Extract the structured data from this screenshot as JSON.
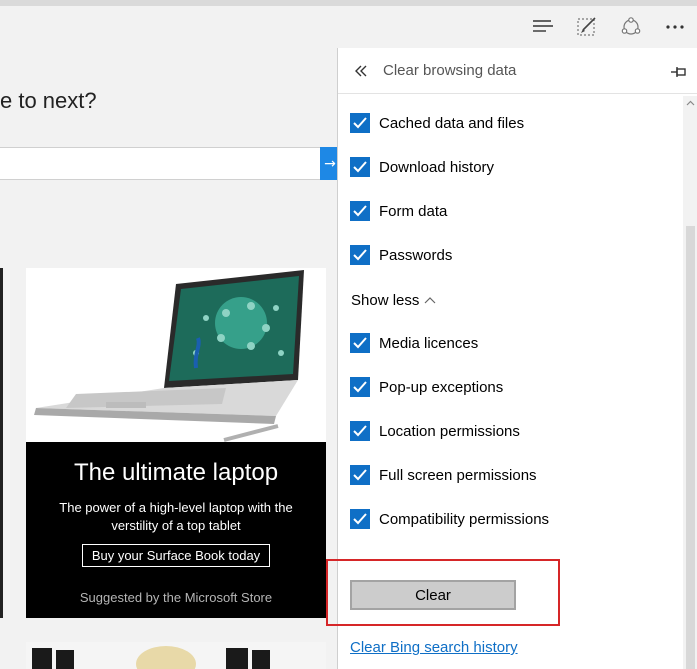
{
  "toolbar": {
    "buttons": [
      {
        "name": "hub",
        "icon": "hub-icon"
      },
      {
        "name": "web-note",
        "icon": "web-note-icon"
      },
      {
        "name": "share",
        "icon": "share-icon"
      },
      {
        "name": "more",
        "icon": "more-icon"
      }
    ]
  },
  "page": {
    "heading": "e to next?",
    "card": {
      "title": "The ultimate laptop",
      "description": "The power of a high-level laptop with the verstility of a top tablet",
      "cta": "Buy your Surface Book today",
      "note": "Suggested by the Microsoft Store"
    }
  },
  "panel": {
    "title": "Clear browsing data",
    "back_icon": "double-chevron-left-icon",
    "pin_icon": "pin-icon",
    "options": [
      {
        "label": "Cached data and files",
        "checked": true
      },
      {
        "label": "Download history",
        "checked": true
      },
      {
        "label": "Form data",
        "checked": true
      },
      {
        "label": "Passwords",
        "checked": true
      },
      {
        "label": "Media licences",
        "checked": true
      },
      {
        "label": "Pop-up exceptions",
        "checked": true
      },
      {
        "label": "Location permissions",
        "checked": true
      },
      {
        "label": "Full screen permissions",
        "checked": true
      },
      {
        "label": "Compatibility permissions",
        "checked": true
      }
    ],
    "show_less": "Show less",
    "clear_button": "Clear",
    "bing_link": "Clear Bing search history"
  },
  "colors": {
    "accent": "#0f6fc6",
    "highlight": "#d62628",
    "card_background": "#000000"
  }
}
